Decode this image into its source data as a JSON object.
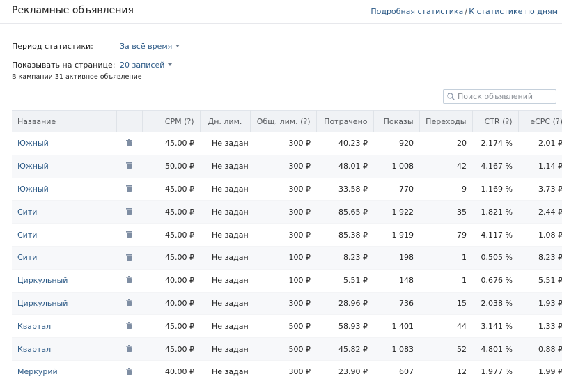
{
  "header": {
    "title": "Рекламные объявления",
    "link_detailed": "Подробная статистика",
    "separator": "/",
    "link_by_day": "К статистике по дням"
  },
  "filters": {
    "period_label": "Период статистики:",
    "period_value": "За всё время",
    "per_page_label": "Показывать на странице:",
    "per_page_value": "20 записей"
  },
  "summary": "В кампании 31 активное объявление",
  "search": {
    "placeholder": "Поиск объявлений",
    "icon": "search-icon"
  },
  "colors": {
    "link": "#2a5885",
    "header_bg": "#f0f2f5",
    "row_alt_bg": "#f7f8fa",
    "icon": "#7f8ea3"
  },
  "table": {
    "columns": [
      "Название",
      "",
      "CPM (?)",
      "Дн. лим.",
      "Общ. лим. (?)",
      "Потрачено",
      "Показы",
      "Переходы",
      "CTR (?)",
      "eCPC (?)"
    ],
    "rows": [
      {
        "name": "Южный",
        "cpm": "45.00 ₽",
        "daily": "Не задан",
        "total": "300 ₽",
        "spent": "40.23 ₽",
        "impressions": "920",
        "clicks": "20",
        "ctr": "2.174 %",
        "ecpc": "2.01 ₽"
      },
      {
        "name": "Южный",
        "cpm": "50.00 ₽",
        "daily": "Не задан",
        "total": "300 ₽",
        "spent": "48.01 ₽",
        "impressions": "1 008",
        "clicks": "42",
        "ctr": "4.167 %",
        "ecpc": "1.14 ₽"
      },
      {
        "name": "Южный",
        "cpm": "45.00 ₽",
        "daily": "Не задан",
        "total": "300 ₽",
        "spent": "33.58 ₽",
        "impressions": "770",
        "clicks": "9",
        "ctr": "1.169 %",
        "ecpc": "3.73 ₽"
      },
      {
        "name": "Сити",
        "cpm": "45.00 ₽",
        "daily": "Не задан",
        "total": "300 ₽",
        "spent": "85.65 ₽",
        "impressions": "1 922",
        "clicks": "35",
        "ctr": "1.821 %",
        "ecpc": "2.44 ₽"
      },
      {
        "name": "Сити",
        "cpm": "45.00 ₽",
        "daily": "Не задан",
        "total": "300 ₽",
        "spent": "85.38 ₽",
        "impressions": "1 919",
        "clicks": "79",
        "ctr": "4.117 %",
        "ecpc": "1.08 ₽"
      },
      {
        "name": "Сити",
        "cpm": "45.00 ₽",
        "daily": "Не задан",
        "total": "100 ₽",
        "spent": "8.23 ₽",
        "impressions": "198",
        "clicks": "1",
        "ctr": "0.505 %",
        "ecpc": "8.23 ₽"
      },
      {
        "name": "Циркульный",
        "cpm": "40.00 ₽",
        "daily": "Не задан",
        "total": "100 ₽",
        "spent": "5.51 ₽",
        "impressions": "148",
        "clicks": "1",
        "ctr": "0.676 %",
        "ecpc": "5.51 ₽"
      },
      {
        "name": "Циркульный",
        "cpm": "40.00 ₽",
        "daily": "Не задан",
        "total": "300 ₽",
        "spent": "28.96 ₽",
        "impressions": "736",
        "clicks": "15",
        "ctr": "2.038 %",
        "ecpc": "1.93 ₽"
      },
      {
        "name": "Квартал",
        "cpm": "45.00 ₽",
        "daily": "Не задан",
        "total": "500 ₽",
        "spent": "58.93 ₽",
        "impressions": "1 401",
        "clicks": "44",
        "ctr": "3.141 %",
        "ecpc": "1.33 ₽"
      },
      {
        "name": "Квартал",
        "cpm": "45.00 ₽",
        "daily": "Не задан",
        "total": "500 ₽",
        "spent": "45.82 ₽",
        "impressions": "1 083",
        "clicks": "52",
        "ctr": "4.801 %",
        "ecpc": "0.88 ₽"
      },
      {
        "name": "Меркурий",
        "cpm": "40.00 ₽",
        "daily": "Не задан",
        "total": "300 ₽",
        "spent": "23.90 ₽",
        "impressions": "607",
        "clicks": "12",
        "ctr": "1.977 %",
        "ecpc": "1.99 ₽"
      }
    ]
  }
}
